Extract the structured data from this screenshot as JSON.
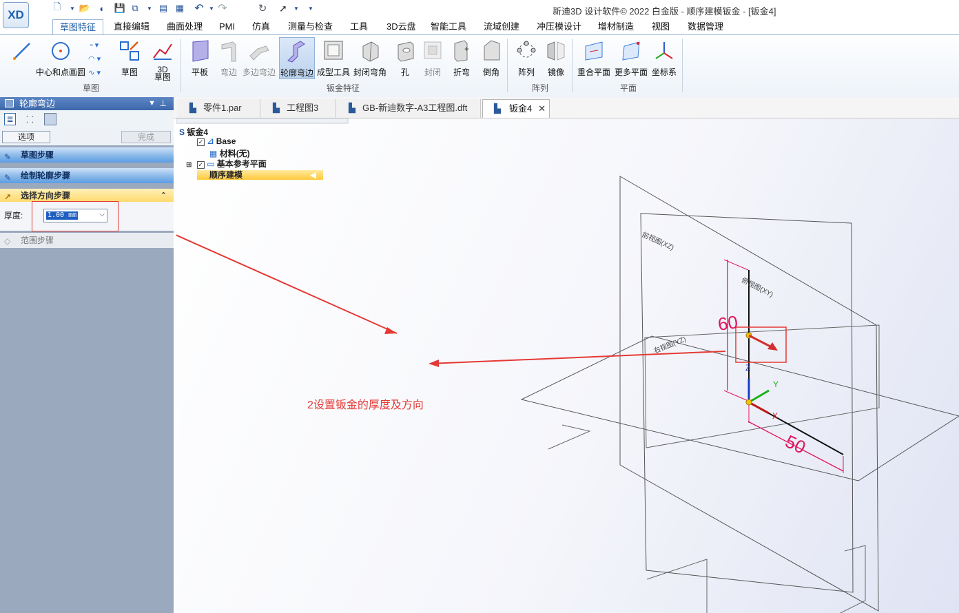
{
  "app": {
    "title": "新迪3D 设计软件© 2022 白金版 - 顺序建模钣金 - [钣金4]",
    "logo": "XD",
    "quick_access": [
      "new-icon",
      "open-icon",
      "save-icon",
      "save-all-icon",
      "properties-icon",
      "undo-icon",
      "redo-icon",
      "select-icon"
    ]
  },
  "tabs": [
    {
      "label": "草图特征",
      "active": true
    },
    {
      "label": "直接编辑"
    },
    {
      "label": "曲面处理"
    },
    {
      "label": "PMI"
    },
    {
      "label": "仿真"
    },
    {
      "label": "测量与检查"
    },
    {
      "label": "工具"
    },
    {
      "label": "3D云盘"
    },
    {
      "label": "智能工具"
    },
    {
      "label": "流域创建"
    },
    {
      "label": "冲压模设计"
    },
    {
      "label": "增材制造"
    },
    {
      "label": "视图"
    },
    {
      "label": "数据管理"
    }
  ],
  "ribbon": {
    "groups": {
      "sketch": "草图",
      "sheetmetal": "钣金特征",
      "pattern": "阵列",
      "plane": "平面"
    },
    "buttons": {
      "center_circle": "中心和点画圆",
      "sketch": "草图",
      "sketch3d": "3D\n草图",
      "tab": "平板",
      "flange": "弯边",
      "contour_multi": "多边弯边",
      "contour_flange": "轮廓弯边",
      "forming": "成型工具",
      "close_corner": "封闭弯角",
      "hole": "孔",
      "seal": "封闭",
      "fold": "折弯",
      "chamfer": "倒角",
      "pattern": "阵列",
      "mirror": "镜像",
      "coincident_plane": "重合平面",
      "more_planes": "更多平面",
      "coord_sys": "坐标系"
    }
  },
  "left_panel": {
    "title": "轮廓弯边",
    "options_btn": "选项",
    "finish_btn": "完成",
    "steps": {
      "sketch": "草图步骤",
      "draw_profile": "绘制轮廓步骤",
      "select_direction": "选择方向步骤",
      "extent": "范围步骤"
    },
    "thickness_label": "厚度:",
    "thickness_value": "1.00 mm"
  },
  "doc_tabs": [
    {
      "label": "零件1.par"
    },
    {
      "label": "工程图3"
    },
    {
      "label": "GB-新迪数字-A3工程图.dft"
    },
    {
      "label": "钣金4",
      "active": true
    }
  ],
  "tree": {
    "root": "钣金4",
    "base": "Base",
    "material": "材料(无)",
    "ref_planes": "基本参考平面",
    "ordered": "顺序建模"
  },
  "viewport": {
    "plane_front": "前视图(XZ)",
    "plane_top": "俯视图(XY)",
    "plane_right": "右视图(YZ)",
    "dim_60": "60",
    "dim_50": "50",
    "axis_x": "X",
    "axis_y": "Y",
    "axis_z": "Z",
    "annotation": "2设置钣金的厚度及方向"
  },
  "colors": {
    "accent": "#1c5aa6",
    "annotation": "#e53935",
    "dimension": "#e0145a"
  }
}
